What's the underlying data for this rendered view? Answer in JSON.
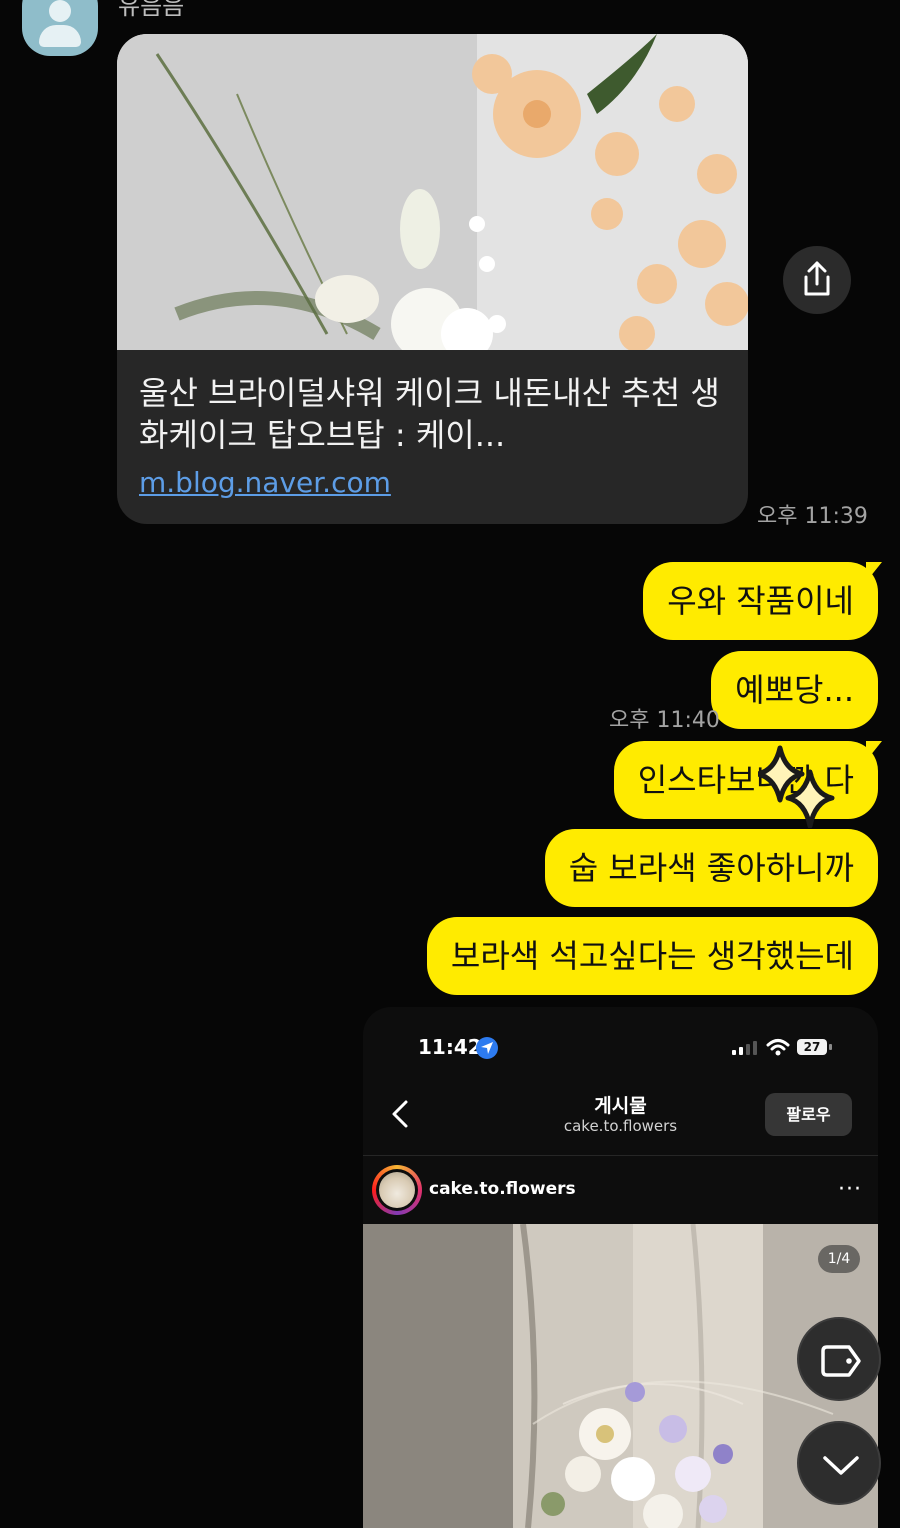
{
  "sender": {
    "name": "유음음"
  },
  "link_card": {
    "title": "울산 브라이덜샤워 케이크 내돈내산 추천 생화케이크 탑오브탑 : 케이...",
    "url": "m.blog.naver.com",
    "share_icon": "share-icon"
  },
  "timestamps": {
    "first": "오후 11:39",
    "second": "오후 11:40"
  },
  "messages": [
    "우와 작품이네",
    "예뽀당...",
    "인스타보니깐  다",
    "숩 보라색 좋아하니까",
    "보라색 석고싶다는 생각했는데"
  ],
  "screenshot": {
    "status_time": "11:42",
    "battery": "27",
    "header_title": "게시물",
    "header_subtitle": "cake.to.flowers",
    "follow_label": "팔로우",
    "post_username": "cake.to.flowers",
    "more_label": "···",
    "image_counter": "1/4"
  },
  "buttons": {
    "tag_icon": "tag-icon",
    "scroll_down_icon": "chevron-down-icon"
  },
  "colors": {
    "bubble": "#ffeb00",
    "background": "#060606",
    "link": "#5d9de6"
  }
}
